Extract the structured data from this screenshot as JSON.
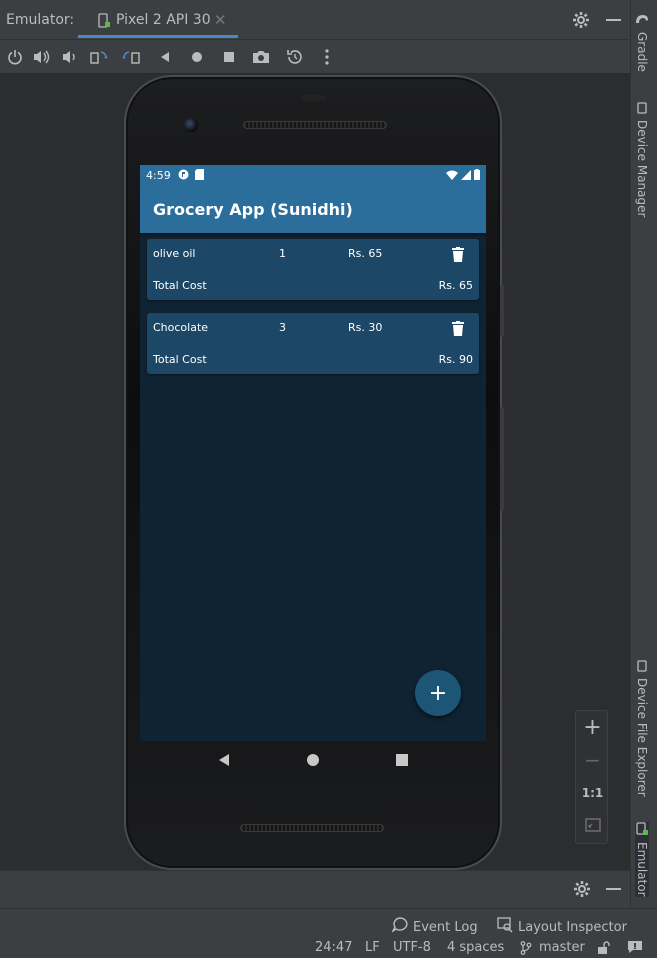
{
  "ide": {
    "tool_window_title": "Emulator:",
    "device_tab": "Pixel 2 API 30",
    "close_glyph": "✕",
    "right_tabs": [
      "Gradle",
      "Device Manager",
      "Device File Explorer",
      "Emulator"
    ],
    "bottom_tools": {
      "event_log": "Event Log",
      "layout_inspector": "Layout Inspector"
    },
    "status": {
      "position": "24:47",
      "line_sep": "LF",
      "encoding": "UTF-8",
      "indent": "4 spaces",
      "branch": "master"
    },
    "zoom": {
      "zoom_in": "+",
      "zoom_out": "−",
      "actual_size": "1:1"
    }
  },
  "device": {
    "status_time": "4:59",
    "app_title": "Grocery App (Sunidhi)",
    "items": [
      {
        "name": "olive oil",
        "quantity": "1",
        "price": "Rs. 65",
        "total_label": "Total Cost",
        "total": "Rs. 65"
      },
      {
        "name": "Chocolate",
        "quantity": "3",
        "price": "Rs. 30",
        "total_label": "Total Cost",
        "total": "Rs. 90"
      }
    ],
    "fab_label": "+"
  },
  "colors": {
    "app_bar": "#2b6d9b",
    "card": "#1d4766",
    "screen_bg": "#102333",
    "fab": "#1d5577"
  }
}
